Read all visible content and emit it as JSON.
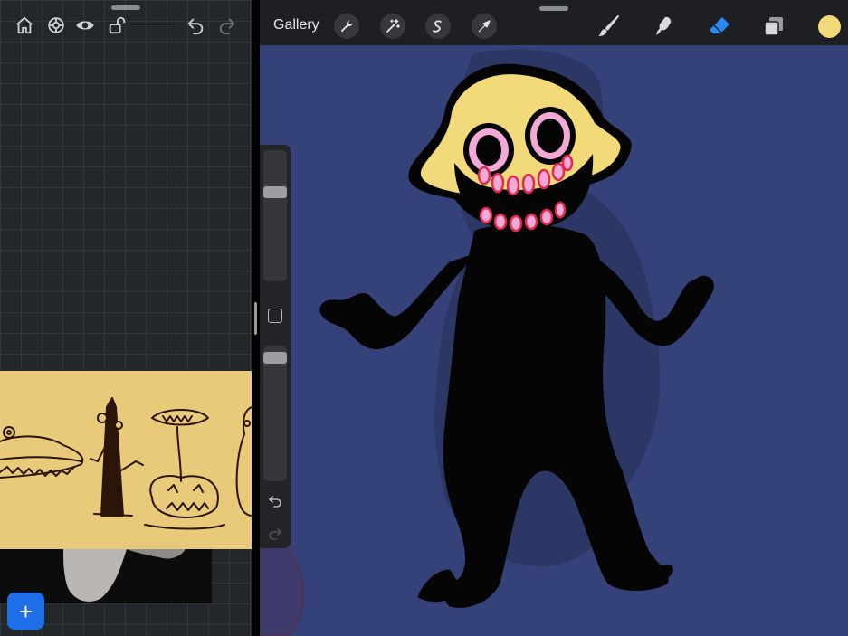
{
  "left_toolbar": {
    "icons": [
      "home-icon",
      "adjust-icon",
      "eye-icon",
      "unlock-icon",
      "undo-icon",
      "redo-icon"
    ]
  },
  "left_pane": {
    "add_button_label": "+"
  },
  "top_bar": {
    "gallery_label": "Gallery",
    "advanced_tools": [
      "wrench-icon",
      "magic-wand-icon",
      "selection-icon",
      "transform-arrow-icon"
    ],
    "paint_tools": [
      "brush-icon",
      "smudge-icon",
      "eraser-icon",
      "layers-icon"
    ],
    "active_tool": "eraser-icon",
    "current_color": "#f2d97a"
  },
  "sidebar": {
    "brush_size_level": 0.7,
    "opacity_level": 0.95,
    "icons": [
      "modify-square-icon",
      "undo-icon",
      "redo-icon"
    ]
  },
  "colors": {
    "canvas_background": "#35427a",
    "toolbar_background": "#1e1f22",
    "accent_blue": "#2a8af5",
    "add_button": "#1f6fe8",
    "character_head": "#f2d97a",
    "character_body": "#050505",
    "character_teeth": "#f2a9d8",
    "reference_sheet": "#e9c97a"
  }
}
